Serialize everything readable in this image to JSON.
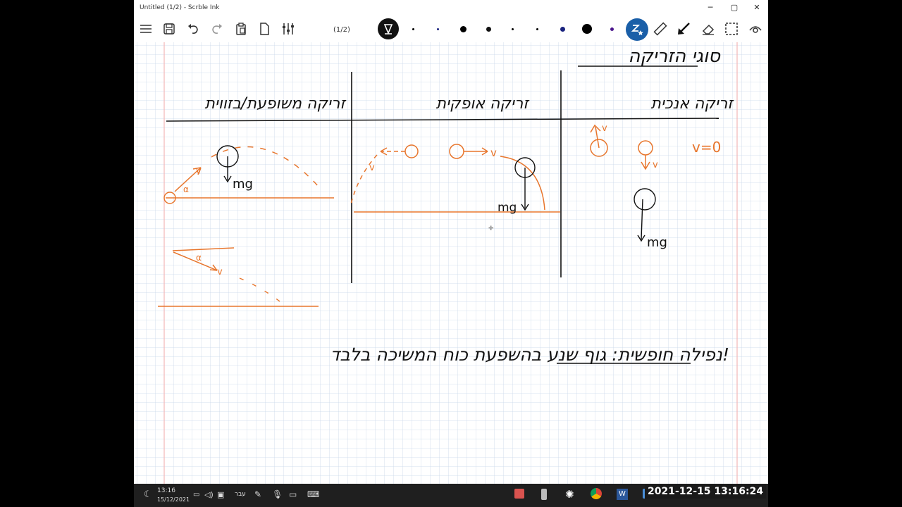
{
  "window": {
    "title": "Untitled (1/2) - Scrble Ink",
    "minimize": "─",
    "maximize": "▢",
    "close": "✕"
  },
  "toolbar": {
    "page_indicator": "(1/2)",
    "accent_color": "#1a5fa8",
    "pen_colors": [
      "#000000",
      "#1a237e",
      "#000000",
      "#1a237e",
      "#000000",
      "#000000",
      "#1a237e",
      "#000000",
      "#4a148c"
    ]
  },
  "notes": {
    "heading": "סוגי הזריקה",
    "col_angled": "זריקה משופעת/בזווית",
    "col_horizontal": "זריקה אופקית",
    "col_vertical": "זריקה אנכית",
    "label_v": "v",
    "label_mg": "mg",
    "label_alpha": "α",
    "label_v0": "v=0",
    "free_fall": "נפילה חופשית: גוף שנע בהשפעת כוח המשיכה בלבד!",
    "ink_black": "#111111",
    "ink_orange": "#e8762d"
  },
  "taskbar": {
    "time": "13:16",
    "date": "15/12/2021",
    "lang": "עבר",
    "overlay_timestamp": "2021-12-15 13:16:24"
  }
}
